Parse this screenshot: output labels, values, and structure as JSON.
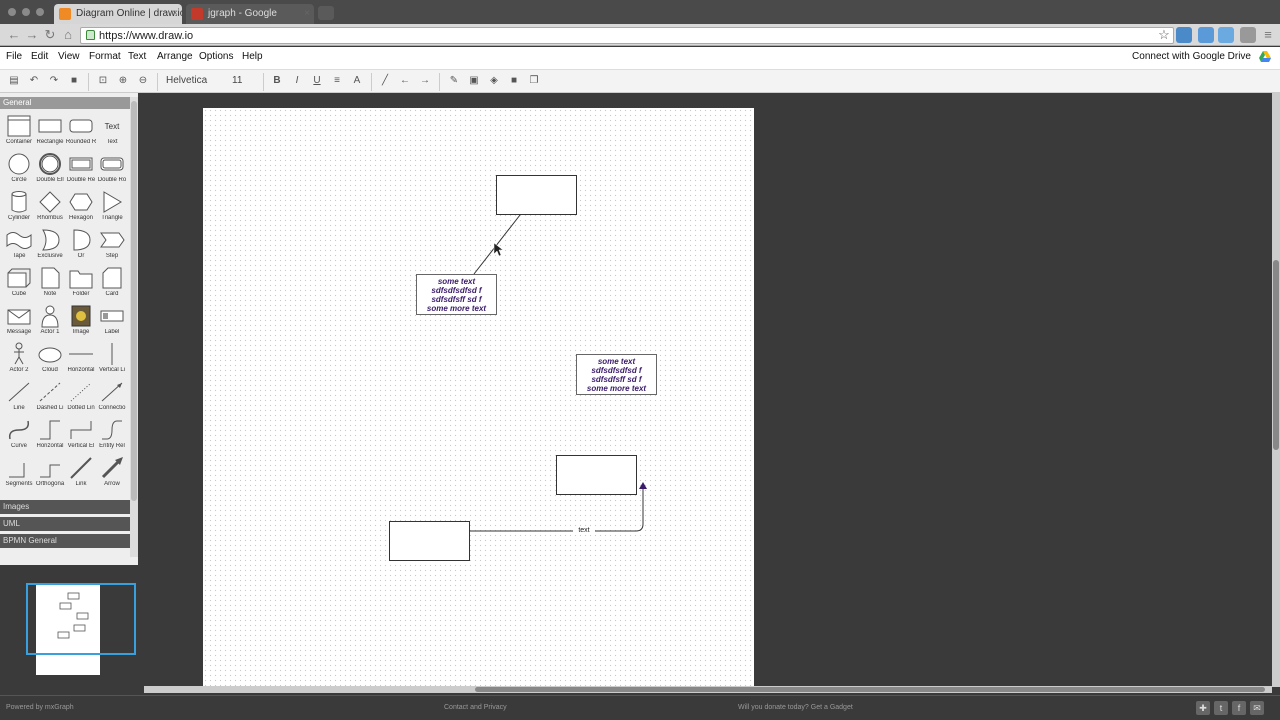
{
  "browser": {
    "tabs": [
      {
        "title": "Diagram Online | draw.io",
        "active": true
      },
      {
        "title": "jgraph - Google",
        "active": false
      }
    ],
    "url": "https://www.draw.io"
  },
  "menu": {
    "items": [
      "File",
      "Edit",
      "View",
      "Format",
      "Text",
      "Arrange",
      "Options",
      "Help"
    ],
    "connect": "Connect with Google Drive"
  },
  "toolbar": {
    "font_name": "Helvetica",
    "font_size": "11",
    "bold": "B",
    "italic": "I",
    "underline": "U",
    "text_tool": "A"
  },
  "sidebar": {
    "header": "General",
    "shapes": [
      {
        "label": "Container",
        "icon": "container-icon"
      },
      {
        "label": "Rectangle",
        "icon": "rectangle-icon"
      },
      {
        "label": "Rounded R",
        "icon": "rounded-rectangle-icon"
      },
      {
        "label": "Text",
        "icon": "text-icon"
      },
      {
        "label": "Circle",
        "icon": "circle-icon"
      },
      {
        "label": "Double Ell",
        "icon": "double-ellipse-icon"
      },
      {
        "label": "Double Re",
        "icon": "double-rectangle-icon"
      },
      {
        "label": "Double Ro",
        "icon": "double-rounded-icon"
      },
      {
        "label": "Cylinder",
        "icon": "cylinder-icon"
      },
      {
        "label": "Rhombus",
        "icon": "rhombus-icon"
      },
      {
        "label": "Hexagon",
        "icon": "hexagon-icon"
      },
      {
        "label": "Triangle",
        "icon": "triangle-icon"
      },
      {
        "label": "Tape",
        "icon": "tape-icon"
      },
      {
        "label": "Exclusive",
        "icon": "exclusive-or-icon"
      },
      {
        "label": "Or",
        "icon": "or-icon"
      },
      {
        "label": "Step",
        "icon": "step-icon"
      },
      {
        "label": "Cube",
        "icon": "cube-icon"
      },
      {
        "label": "Note",
        "icon": "note-icon"
      },
      {
        "label": "Folder",
        "icon": "folder-icon"
      },
      {
        "label": "Card",
        "icon": "card-icon"
      },
      {
        "label": "Message",
        "icon": "message-icon"
      },
      {
        "label": "Actor 1",
        "icon": "actor-icon"
      },
      {
        "label": "Image",
        "icon": "image-icon"
      },
      {
        "label": "Label",
        "icon": "label-icon"
      },
      {
        "label": "Actor 2",
        "icon": "actor-stick-icon"
      },
      {
        "label": "Cloud",
        "icon": "cloud-icon"
      },
      {
        "label": "Horizontal",
        "icon": "horizontal-line-icon"
      },
      {
        "label": "Vertical Li",
        "icon": "vertical-line-icon"
      },
      {
        "label": "Line",
        "icon": "line-icon"
      },
      {
        "label": "Dashed Li",
        "icon": "dashed-line-icon"
      },
      {
        "label": "Dotted Lin",
        "icon": "dotted-line-icon"
      },
      {
        "label": "Connectio",
        "icon": "connection-icon"
      },
      {
        "label": "Curve",
        "icon": "curve-icon"
      },
      {
        "label": "Horizontal",
        "icon": "horizontal-elbow-icon"
      },
      {
        "label": "Vertical El",
        "icon": "vertical-elbow-icon"
      },
      {
        "label": "Entity Rel",
        "icon": "entity-relation-icon"
      },
      {
        "label": "Segments",
        "icon": "segments-icon"
      },
      {
        "label": "Orthogona",
        "icon": "orthogonal-icon"
      },
      {
        "label": "Link",
        "icon": "link-icon"
      },
      {
        "label": "Arrow",
        "icon": "arrow-icon"
      }
    ],
    "sections": [
      "Images",
      "UML",
      "BPMN General"
    ]
  },
  "diagram": {
    "textbox_a": [
      "some text",
      "sdfsdfsdfsd f",
      "sdfsdfsff sd f",
      "some more text"
    ],
    "textbox_b": [
      "some text",
      "sdfsdfsdfsd f",
      "sdfsdfsff sd f",
      "some more text"
    ],
    "edge_label": "text"
  },
  "footer": {
    "left": "Powered by mxGraph",
    "center": "Contact and Privacy",
    "right": "Will you donate today? Get a Gadget"
  },
  "colors": {
    "accent": "#39a0e0",
    "textbox_text": "#3a1a6a",
    "canvas_bg": "#3a3a3a"
  }
}
